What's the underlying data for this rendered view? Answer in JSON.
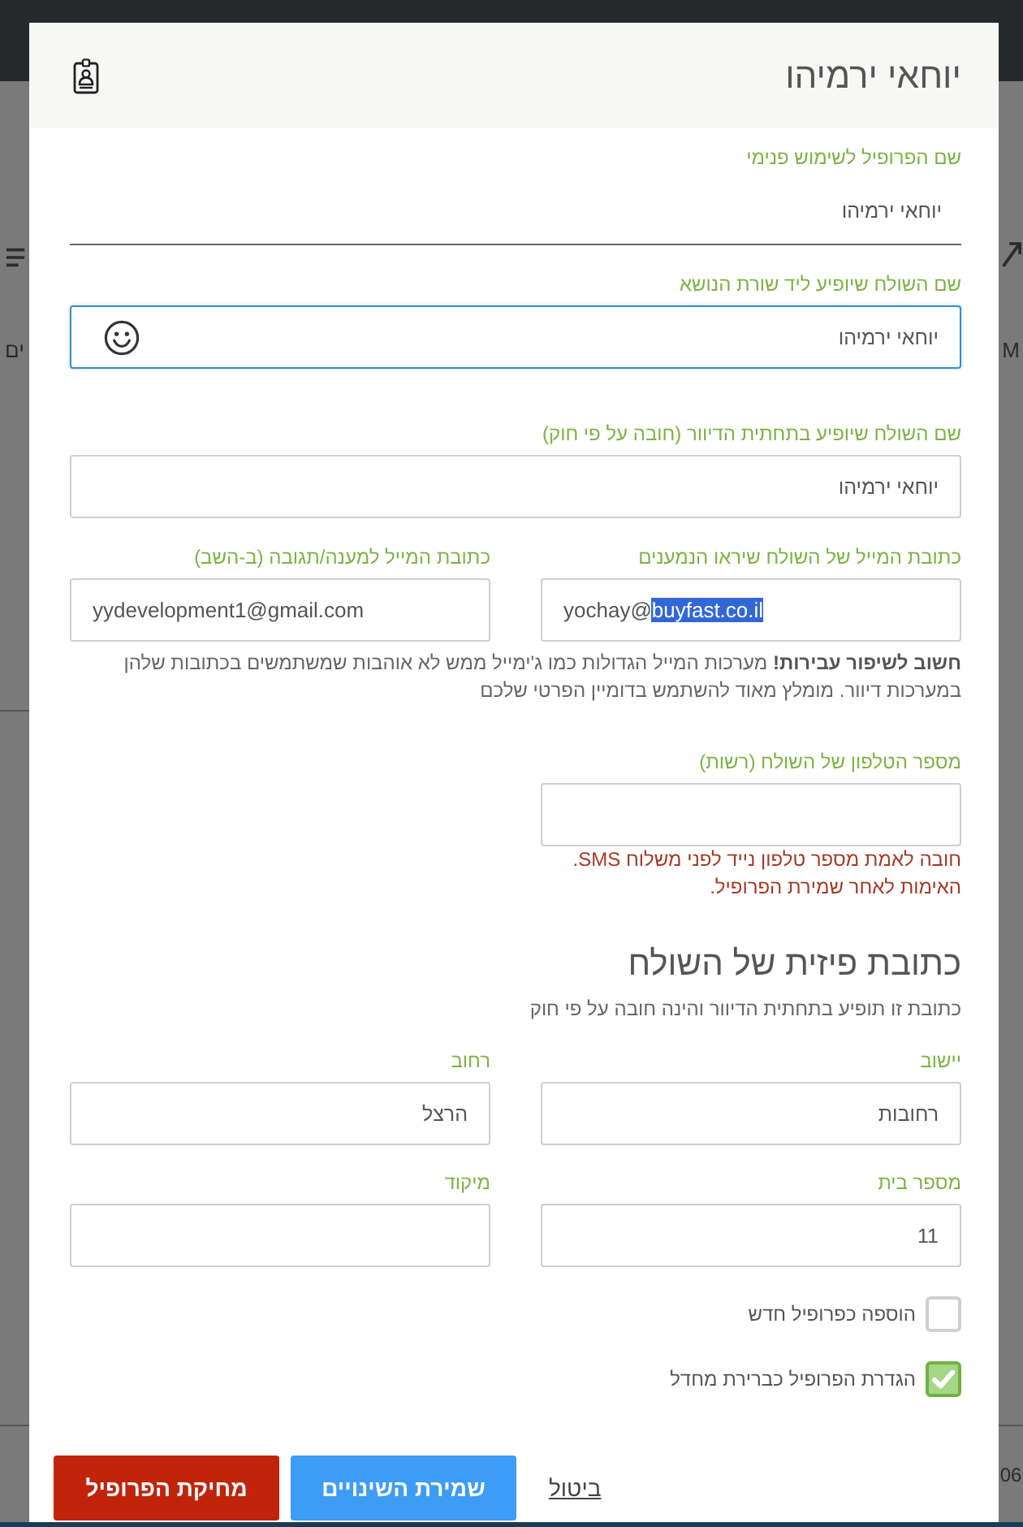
{
  "background_page": {
    "left_edge_text": "ים",
    "right_edge_text": "M",
    "bottom_right_text": "06"
  },
  "dialog": {
    "title": "יוחאי ירמיהו",
    "profile_fields": [
      {
        "kind": "underline",
        "label": "שם הפרופיל לשימוש פנימי",
        "value": "יוחאי ירמיהו",
        "focused": false
      },
      {
        "kind": "emoji",
        "label": "שם השולח שיופיע ליד שורת הנושא",
        "value": "יוחאי ירמיהו",
        "focused": true
      },
      {
        "kind": "box",
        "label": "שם השולח שיופיע בתחתית הדיוור (חובה על פי חוק)",
        "value": "יוחאי ירמיהו",
        "focused": false
      }
    ],
    "email_fields": [
      {
        "label": "כתובת המייל של השולח שיראו הנמענים",
        "value": "yochay@",
        "selected_text": "buyfast.co.il"
      },
      {
        "label": "כתובת המייל למענה/תגובה (ב-השב)",
        "value": "yydevelopment1@gmail.com"
      }
    ],
    "email_note": "**חשוב לשיפור עבירות!** מערכות המייל הגדולות כמו ג'ימייל ממש לא אוהבות שמשתמשים בכתובות שלהן במערכות דיוור. מומלץ מאוד להשתמש בדומיין הפרטי שלכם",
    "phone_field": {
      "label": "מספר הטלפון של השולח (רשות)"
    },
    "phone_error_lines": [
      "חובה לאמת מספר טלפון נייד לפני משלוח SMS.",
      "האימות לאחר שמירת הפרופיל."
    ],
    "address": {
      "heading": "כתובת פיזית של השולח",
      "subtitle": "כתובת זו תופיע בתחתית הדיוור והינה חובה על פי חוק",
      "fields": [
        {
          "label": "יישוב",
          "value": "רחובות"
        },
        {
          "label": "רחוב",
          "value": "הרצל"
        },
        {
          "label": "מספר בית",
          "value": "11"
        },
        {
          "label": "מיקוד"
        }
      ]
    },
    "checkboxes": [
      {
        "label": "הוספה כפרופיל חדש",
        "checked": false
      },
      {
        "label": "הגדרת הפרופיל כברירת מחדל",
        "checked": true
      }
    ],
    "buttons": [
      {
        "kind": "link",
        "label": "ביטול"
      },
      {
        "kind": "primary",
        "label": "שמירת השינויים"
      },
      {
        "kind": "danger",
        "label": "מחיקת הפרופיל"
      }
    ]
  }
}
